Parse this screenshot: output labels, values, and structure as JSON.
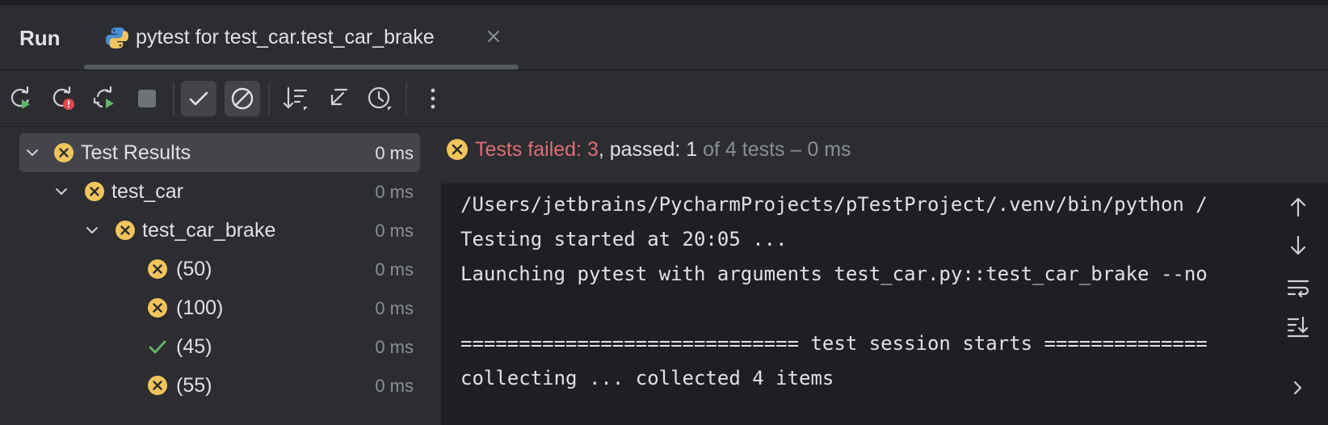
{
  "header": {
    "run_label": "Run",
    "tab_title": "pytest for test_car.test_car_brake"
  },
  "toolbar": {
    "buttons": [
      {
        "name": "rerun",
        "icon": "rerun-icon"
      },
      {
        "name": "rerun-failed",
        "icon": "rerun-failed-icon"
      },
      {
        "name": "toggle-auto-test",
        "icon": "auto-test-icon"
      },
      {
        "name": "stop",
        "icon": "stop-icon"
      },
      {
        "name": "show-passed",
        "icon": "check-icon",
        "active": true
      },
      {
        "name": "show-ignored",
        "icon": "ignored-icon",
        "active": true
      },
      {
        "name": "sort",
        "icon": "sort-icon"
      },
      {
        "name": "import-tests",
        "icon": "import-icon"
      },
      {
        "name": "history",
        "icon": "history-icon"
      },
      {
        "name": "more",
        "icon": "more-vertical-icon"
      }
    ]
  },
  "tree": {
    "rows": [
      {
        "label": "Test Results",
        "time": "0 ms",
        "status": "failed",
        "selected": true
      },
      {
        "label": "test_car",
        "time": "0 ms",
        "status": "failed"
      },
      {
        "label": "test_car_brake",
        "time": "0 ms",
        "status": "failed"
      },
      {
        "label": "(50)",
        "time": "0 ms",
        "status": "failed"
      },
      {
        "label": "(100)",
        "time": "0 ms",
        "status": "failed"
      },
      {
        "label": "(45)",
        "time": "0 ms",
        "status": "passed"
      },
      {
        "label": "(55)",
        "time": "0 ms",
        "status": "failed"
      }
    ]
  },
  "summary": {
    "failed_text": "Tests failed: 3",
    "passed_text": ", passed: 1",
    "rest_text": " of 4 tests – 0 ms"
  },
  "console": {
    "lines": [
      "/Users/jetbrains/PycharmProjects/pTestProject/.venv/bin/python /",
      "Testing started at 20:05 ...",
      "Launching pytest with arguments test_car.py::test_car_brake --no",
      "",
      "============================= test session starts ==============",
      "collecting ... collected 4 items"
    ]
  },
  "colors": {
    "background": "#2b2d30",
    "console_bg": "#1e1f22",
    "failed_badge": "#f2c55c",
    "failed_text": "#e06c75",
    "passed_check": "#5fb865"
  },
  "side_tools": [
    "arrow-up-icon",
    "arrow-down-icon",
    "soft-wrap-icon",
    "scroll-to-end-icon",
    "chevron-right-icon"
  ]
}
